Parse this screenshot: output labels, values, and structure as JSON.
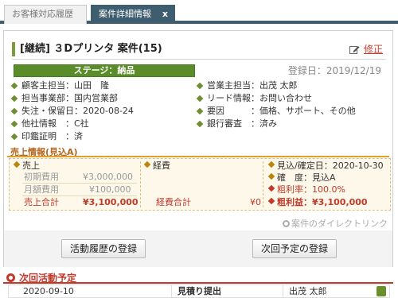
{
  "tabs": [
    {
      "label": "お客様対応履歴",
      "active": false
    },
    {
      "label": "案件詳細情報",
      "active": true,
      "close": "x"
    }
  ],
  "deal": {
    "title": "[継続] ３Dプリンタ 案件(15)",
    "edit_label": "修正",
    "stage": "ステージ：納品",
    "registered": "登録日：2019/12/19",
    "left_fields": [
      "顧客主担当：山田　隆",
      "担当事業部：国内営業部",
      "失注・保留日：2020-08-24",
      "他社情報　：C社",
      "印鑑証明　：済"
    ],
    "right_fields": [
      "営業主担当：出茂 太郎",
      "リード情報：お問い合わせ",
      "要因　　　：価格、サポート、その他",
      "銀行審査　：済み"
    ]
  },
  "sales": {
    "title": "売上情報(見込A)",
    "revenue_label": "売上",
    "initial_label": "初期費用",
    "initial_value": "¥3,000,000",
    "monthly_label": "月額費用",
    "monthly_value": "¥100,000",
    "total_label": "売上合計",
    "total_value": "¥3,100,000",
    "expense_label": "経費",
    "expense_total_label": "経費合計",
    "expense_total_value": "¥0",
    "forecast_date": "見込/確定日：2020-10-30",
    "certainty": "確　度：見込A",
    "margin_rate": "粗利率：100.0%",
    "gross_profit": "粗利益：¥3,100,000"
  },
  "direct_link": "案件のダイレクトリンク",
  "buttons": {
    "register_activity": "活動履歴の登録",
    "register_plan": "次回予定の登録"
  },
  "next_activity": {
    "title": "次回活動予定",
    "row": {
      "date": "2020-09-10",
      "task": "見積り提出",
      "owner": "出茂 太郎"
    }
  },
  "colors": {
    "tab_active": "#3e5d6f",
    "stage_green": "#5b8c2a",
    "accent_red": "#c0392b",
    "sales_orange": "#e0a030"
  }
}
